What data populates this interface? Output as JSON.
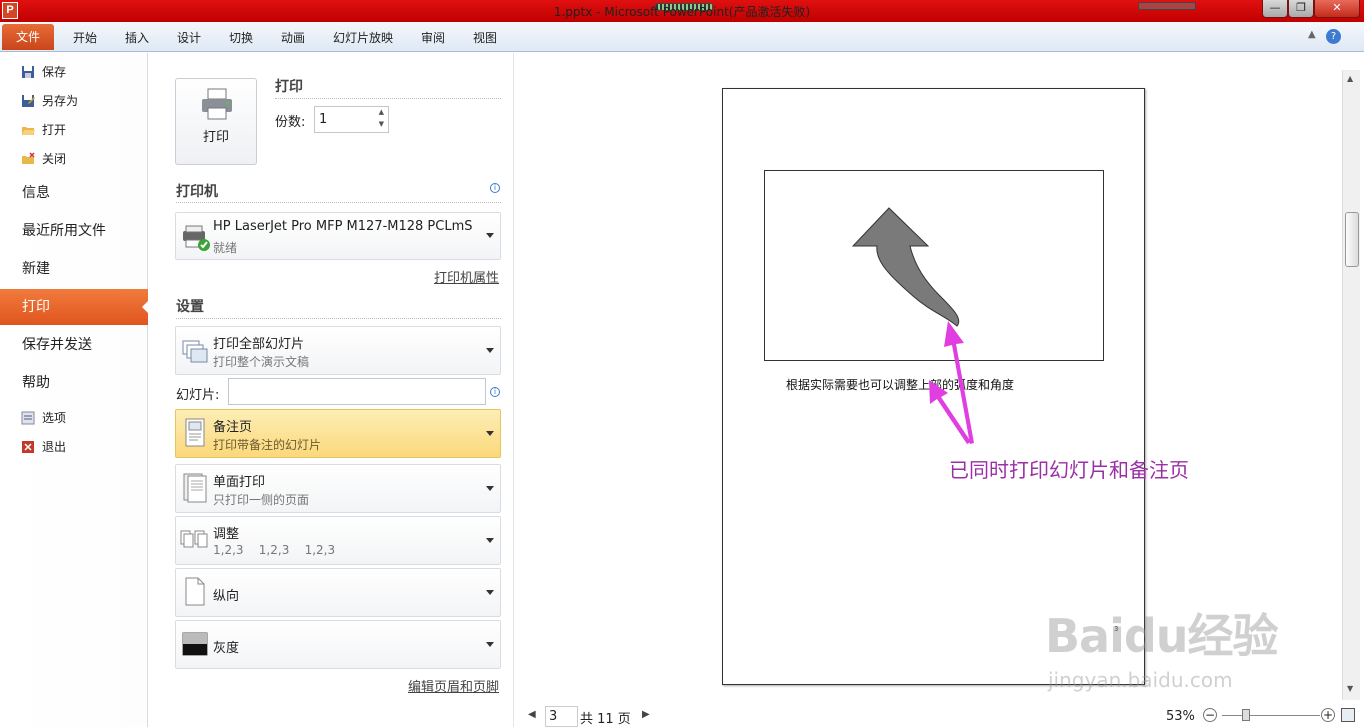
{
  "titlebar": {
    "title": "1.pptx - Microsoft PowerPoint(产品激活失败)",
    "app_icon": "P",
    "controls": {
      "minimize": "—",
      "maximize": "❐",
      "close": "✕"
    }
  },
  "ribbon": {
    "file_tab": "文件",
    "tabs": [
      "开始",
      "插入",
      "设计",
      "切换",
      "动画",
      "幻灯片放映",
      "审阅",
      "视图"
    ],
    "help": "?"
  },
  "nav": {
    "save": "保存",
    "save_as": "另存为",
    "open": "打开",
    "close": "关闭",
    "info": "信息",
    "recent": "最近所用文件",
    "new": "新建",
    "print": "打印",
    "save_send": "保存并发送",
    "help": "帮助",
    "options": "选项",
    "exit": "退出"
  },
  "print": {
    "button_label": "打印",
    "heading": "打印",
    "copies_label": "份数:",
    "copies_value": "1",
    "printer_heading": "打印机",
    "printer_name": "HP LaserJet Pro MFP M127-M128 PCLmS",
    "printer_status": "就绪",
    "printer_props": "打印机属性",
    "settings_heading": "设置",
    "range_title": "打印全部幻灯片",
    "range_sub": "打印整个演示文稿",
    "slides_label": "幻灯片:",
    "slides_value": "",
    "layout_title": "备注页",
    "layout_sub": "打印带备注的幻灯片",
    "sides_title": "单面打印",
    "sides_sub": "只打印一侧的页面",
    "collate_title": "调整",
    "collate_sub": "1,2,3    1,2,3    1,2,3",
    "orientation": "纵向",
    "color": "灰度",
    "edit_header": "编辑页眉和页脚"
  },
  "preview": {
    "notes_text": "根据实际需要也可以调整上部的弧度和角度",
    "annotation": "已同时打印幻灯片和备注页",
    "page_number_mark": "3",
    "annotation_color": "#9b2fa8",
    "arrow_color": "#e03ee0"
  },
  "pager": {
    "current": "3",
    "total": "共 11 页"
  },
  "zoom": {
    "level": "53%",
    "minus": "−",
    "plus": "+"
  },
  "watermark": {
    "brand": "Baidu经验",
    "url": "jingyan.baidu.com"
  }
}
